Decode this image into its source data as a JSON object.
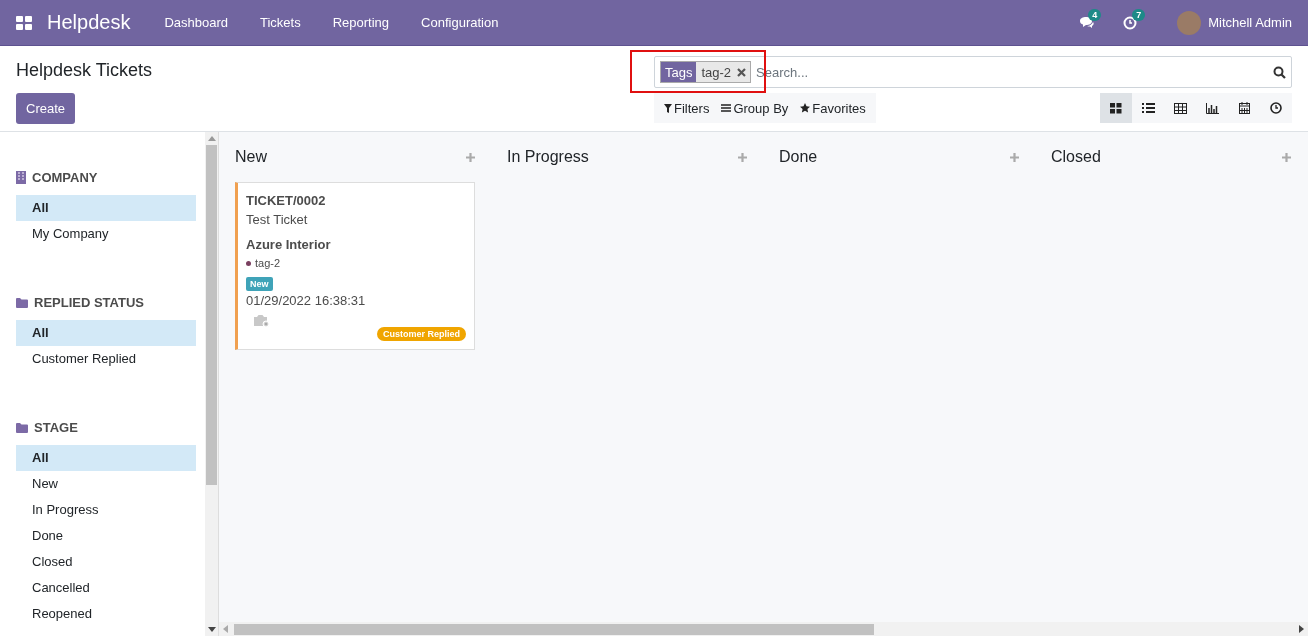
{
  "navbar": {
    "app_name": "Helpdesk",
    "menu": [
      "Dashboard",
      "Tickets",
      "Reporting",
      "Configuration"
    ],
    "messages_count": "4",
    "activities_count": "7",
    "user_name": "Mitchell Admin"
  },
  "page_title": "Helpdesk Tickets",
  "create_button": "Create",
  "search": {
    "facet_label": "Tags",
    "facet_value": "tag-2",
    "placeholder": "Search...",
    "highlighted": true
  },
  "search_options": [
    "Filters",
    "Group By",
    "Favorites"
  ],
  "views": [
    {
      "kind": "kanban",
      "selected": true
    },
    {
      "kind": "list",
      "selected": false
    },
    {
      "kind": "pivot",
      "selected": false
    },
    {
      "kind": "graph",
      "selected": false
    },
    {
      "kind": "calendar",
      "selected": false
    },
    {
      "kind": "activity",
      "selected": false
    }
  ],
  "sidebar": [
    {
      "kind": "company",
      "title": "COMPANY",
      "items": [
        {
          "label": "All",
          "selected": true
        },
        {
          "label": "My Company",
          "selected": false
        }
      ]
    },
    {
      "kind": "folder",
      "title": "REPLIED STATUS",
      "items": [
        {
          "label": "All",
          "selected": true
        },
        {
          "label": "Customer Replied",
          "selected": false
        }
      ]
    },
    {
      "kind": "folder",
      "title": "STAGE",
      "items": [
        {
          "label": "All",
          "selected": true
        },
        {
          "label": "New",
          "selected": false
        },
        {
          "label": "In Progress",
          "selected": false
        },
        {
          "label": "Done",
          "selected": false
        },
        {
          "label": "Closed",
          "selected": false
        },
        {
          "label": "Cancelled",
          "selected": false
        },
        {
          "label": "Reopened",
          "selected": false
        }
      ]
    }
  ],
  "columns": [
    {
      "title": "New",
      "cards": [
        {
          "number": "TICKET/0002",
          "name": "Test Ticket",
          "customer": "Azure Interior",
          "tags": [
            {
              "label": "tag-2",
              "color": "#7a3f5f"
            }
          ],
          "stage_badge": "New",
          "date": "01/29/2022 16:38:31",
          "status_badge": "Customer Replied",
          "color": "#f0a050"
        }
      ]
    },
    {
      "title": "In Progress"
    },
    {
      "title": "Done"
    },
    {
      "title": "Closed"
    }
  ]
}
